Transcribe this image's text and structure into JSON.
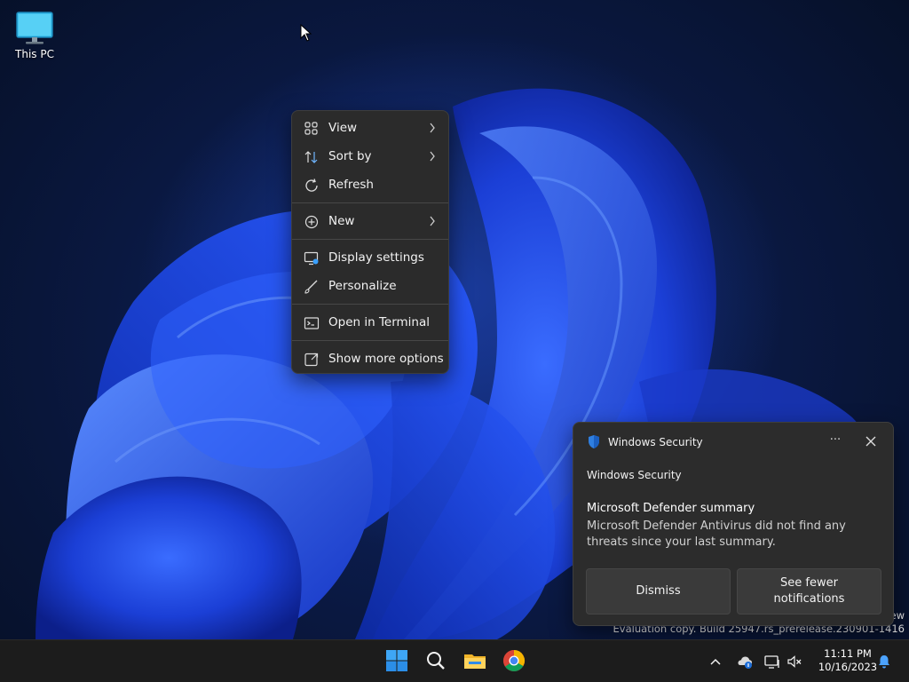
{
  "desktop": {
    "icons": [
      {
        "label": "This PC",
        "icon": "monitor-icon"
      }
    ]
  },
  "context_menu": {
    "items": [
      {
        "label": "View",
        "icon": "grid-view-icon",
        "submenu": true
      },
      {
        "label": "Sort by",
        "icon": "sort-arrows-icon",
        "submenu": true
      },
      {
        "label": "Refresh",
        "icon": "refresh-icon",
        "submenu": false
      },
      {
        "label": "New",
        "icon": "plus-circle-icon",
        "submenu": true
      },
      {
        "label": "Display settings",
        "icon": "display-settings-icon",
        "submenu": false
      },
      {
        "label": "Personalize",
        "icon": "brush-icon",
        "submenu": false
      },
      {
        "label": "Open in Terminal",
        "icon": "terminal-icon",
        "submenu": false
      },
      {
        "label": "Show more options",
        "icon": "external-options-icon",
        "submenu": false
      }
    ]
  },
  "toast": {
    "app_name": "Windows Security",
    "more_label": "···",
    "subtitle": "Windows Security",
    "title": "Microsoft Defender summary",
    "body": "Microsoft Defender Antivirus did not find any threats since your last summary.",
    "buttons": {
      "dismiss": "Dismiss",
      "fewer": "See fewer notifications"
    }
  },
  "watermark": {
    "line1": "ew",
    "line2": "Evaluation copy. Build 25947.rs_prerelease.230901-1416"
  },
  "taskbar": {
    "time": "11:11 PM",
    "date": "10/16/2023"
  },
  "colors": {
    "accent": "#0078d4",
    "menu_bg": "#2b2b2b",
    "toast_bg": "#2c2c2c",
    "taskbar_bg": "#1c1c1c"
  }
}
